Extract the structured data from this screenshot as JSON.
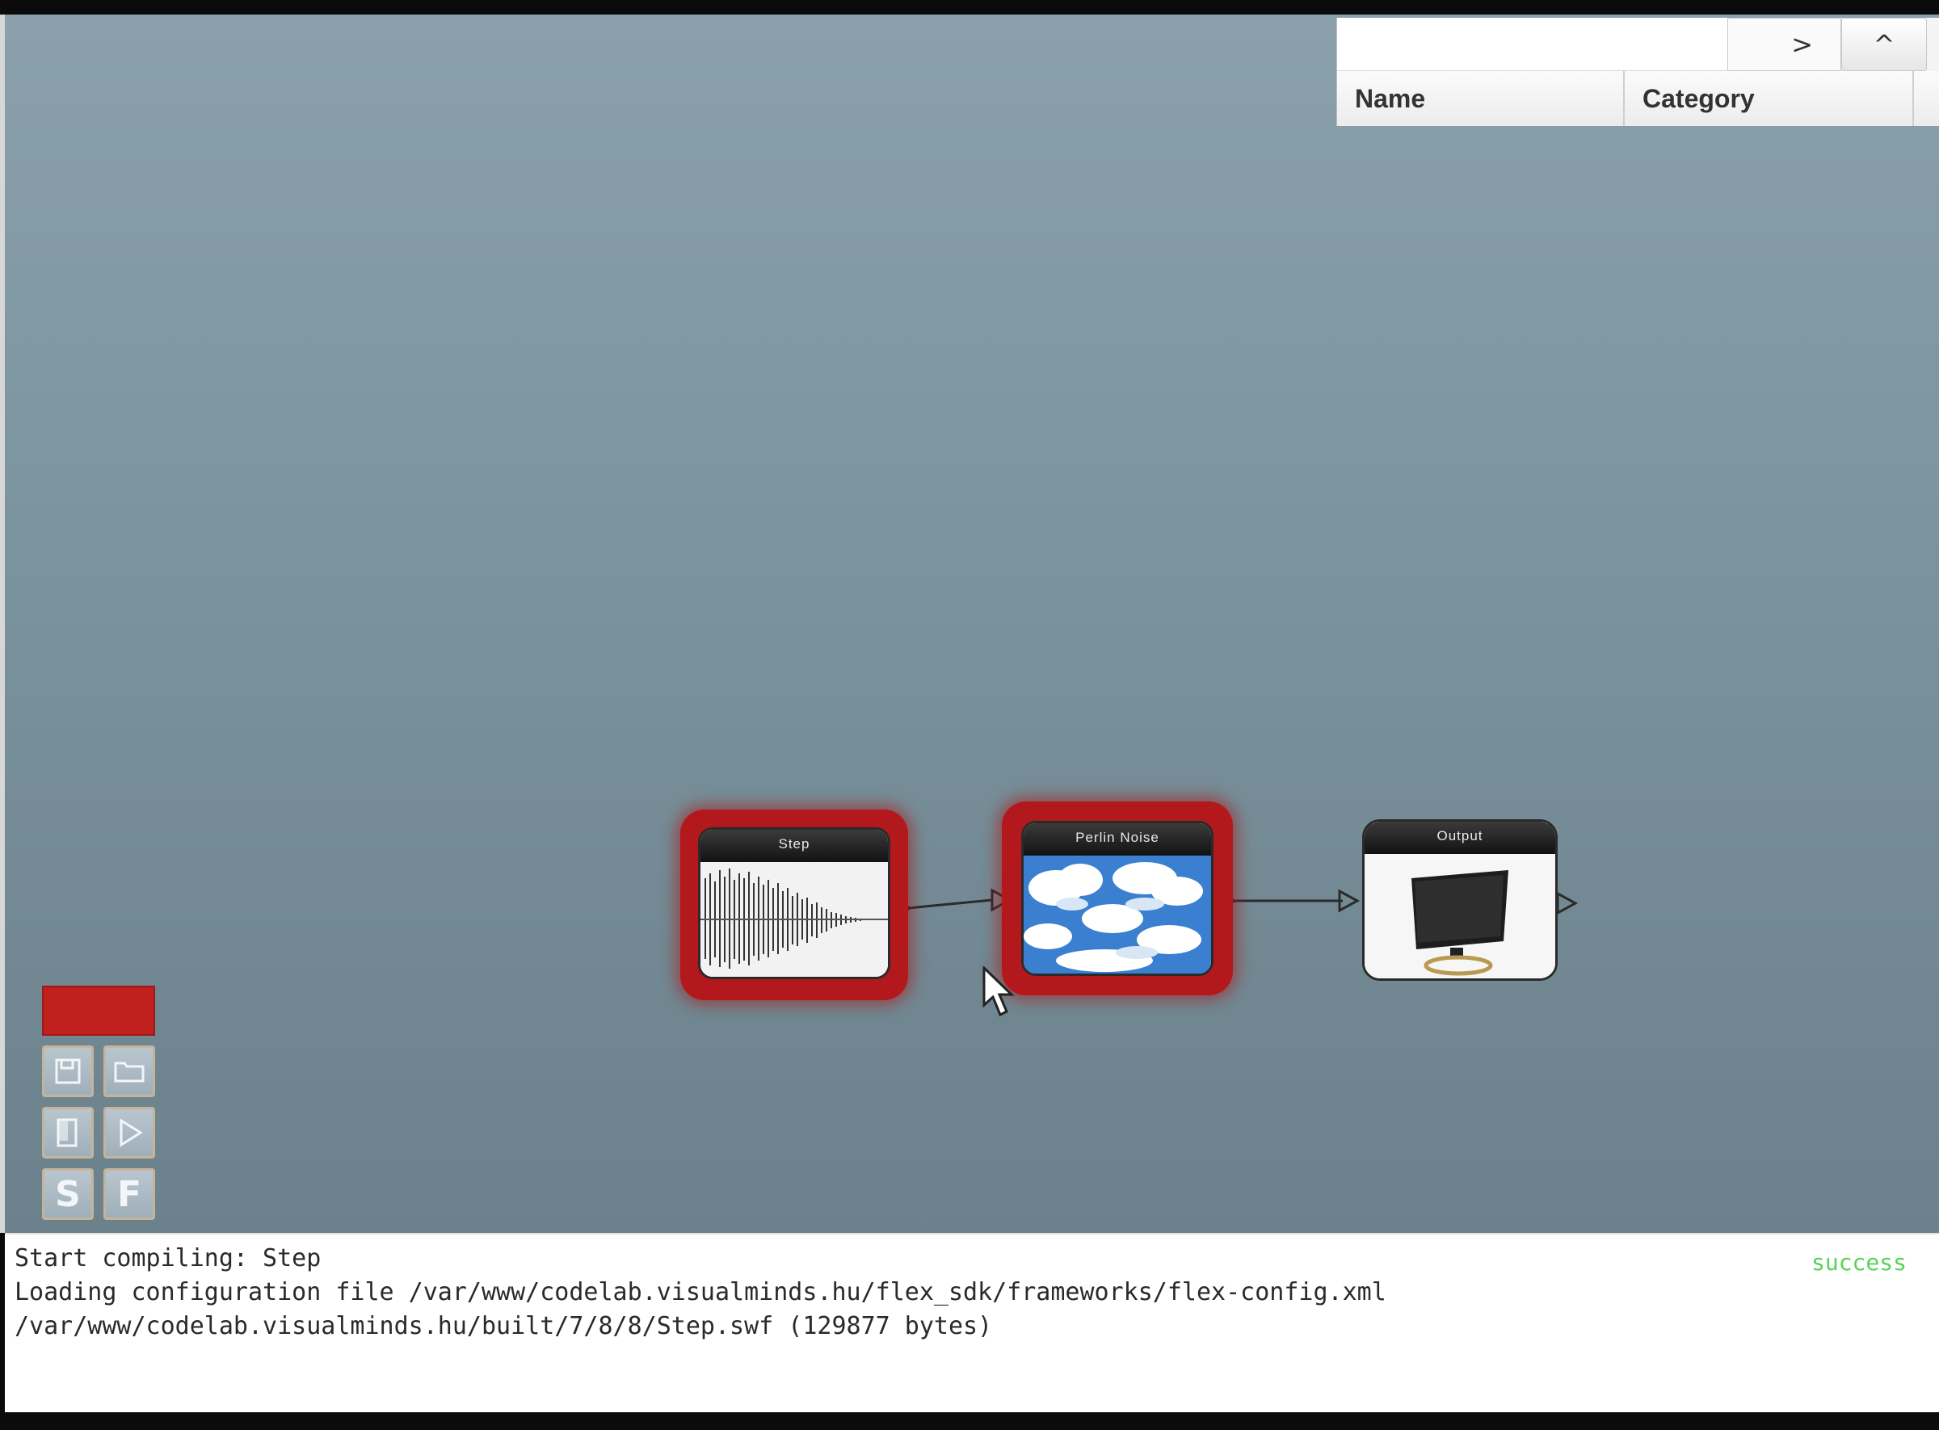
{
  "library": {
    "search_value": "",
    "go_label": ">",
    "collapse_label": "^",
    "columns": {
      "name": "Name",
      "category": "Category"
    }
  },
  "nodes": [
    {
      "title": "Step",
      "selected": true,
      "image": "waveform"
    },
    {
      "title": "Perlin Noise",
      "selected": true,
      "image": "clouds"
    },
    {
      "title": "Output",
      "selected": false,
      "image": "monitor"
    }
  ],
  "toolbox": {
    "icons": [
      "save-icon",
      "open-icon",
      "copy-icon",
      "play-icon"
    ],
    "s_label": "S",
    "f_label": "F"
  },
  "console": {
    "lines": [
      "Start compiling: Step",
      "Loading configuration file /var/www/codelab.visualminds.hu/flex_sdk/frameworks/flex-config.xml",
      "/var/www/codelab.visualminds.hu/built/7/8/8/Step.swf (129877 bytes)"
    ],
    "status": "success"
  },
  "colors": {
    "canvas_top": "#8aa1ab",
    "canvas_bottom": "#6b818b",
    "selected_node": "#b3191c",
    "status": "#5ad15a"
  }
}
